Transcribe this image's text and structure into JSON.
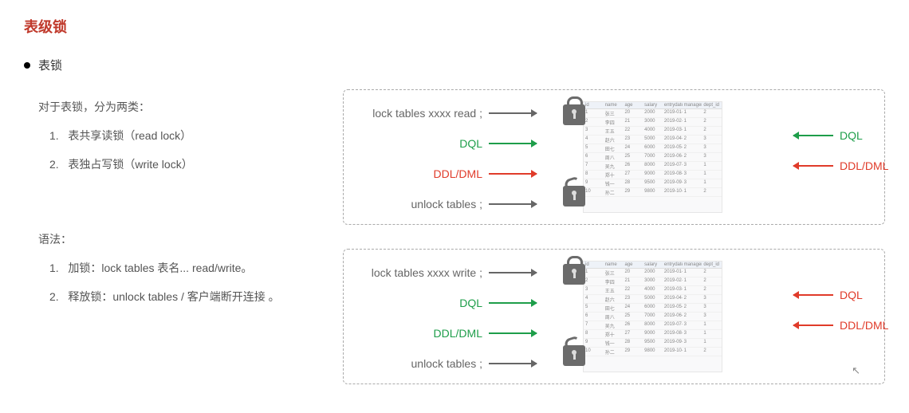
{
  "title": "表级锁",
  "bullet": "表锁",
  "intro": "对于表锁，分为两类：",
  "types": {
    "n1": "1.",
    "t1": "表共享读锁（read lock）",
    "n2": "2.",
    "t2": "表独占写锁（write lock）"
  },
  "syntaxTitle": "语法：",
  "syntax": {
    "n1": "1.",
    "s1": "加锁：lock tables  表名...  read/write。",
    "n2": "2.",
    "s2": "释放锁：unlock  tables / 客户端断开连接 。"
  },
  "d1": {
    "r1": "lock tables xxxx read ;",
    "r2": "DQL",
    "r3": "DDL/DML",
    "r4": "unlock tables ;",
    "right1": "DQL",
    "right2": "DDL/DML"
  },
  "d2": {
    "r1": "lock tables xxxx write ;",
    "r2": "DQL",
    "r3": "DDL/DML",
    "r4": "unlock tables ;",
    "right1": "DQL",
    "right2": "DDL/DML"
  },
  "tableHeaders": [
    "id",
    "name",
    "age",
    "salary",
    "entrydate",
    "managerid",
    "dept_id"
  ]
}
